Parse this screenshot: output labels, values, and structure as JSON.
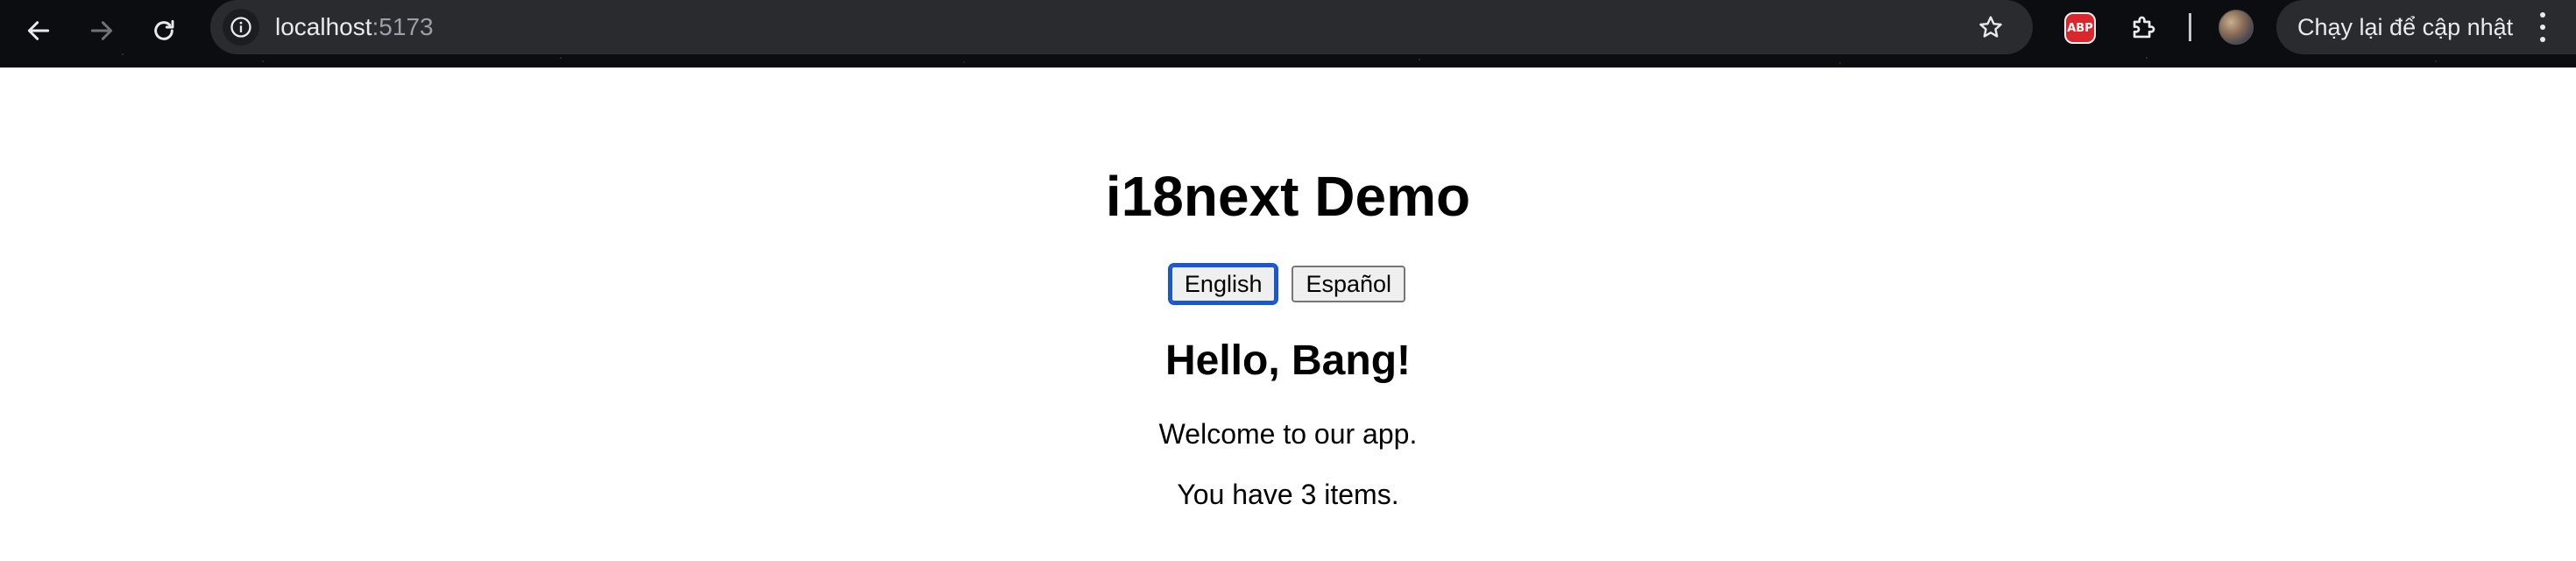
{
  "browser": {
    "toolbar": {
      "back_icon": "arrow-left-icon",
      "forward_icon": "arrow-right-icon",
      "reload_icon": "reload-icon"
    },
    "omnibox": {
      "site_info_icon": "info-icon",
      "host": "localhost",
      "port": ":5173",
      "bookmark_icon": "star-icon"
    },
    "extensions": {
      "adblock_label": "ABP",
      "puzzle_icon": "extensions-puzzle-icon"
    },
    "relaunch": {
      "label": "Chạy lại để cập nhật",
      "menu_icon": "kebab-menu-icon"
    }
  },
  "page": {
    "title": "i18next Demo",
    "language_buttons": [
      {
        "label": "English",
        "selected": true
      },
      {
        "label": "Español",
        "selected": false
      }
    ],
    "greeting": "Hello, Bang!",
    "welcome": "Welcome to our app.",
    "items_text": "You have 3 items."
  },
  "colors": {
    "chrome_bg": "#0c0d10",
    "omnibox_bg": "#2a2b2f",
    "focus_ring": "#1a57d0",
    "adblock_red": "#d9272d"
  }
}
